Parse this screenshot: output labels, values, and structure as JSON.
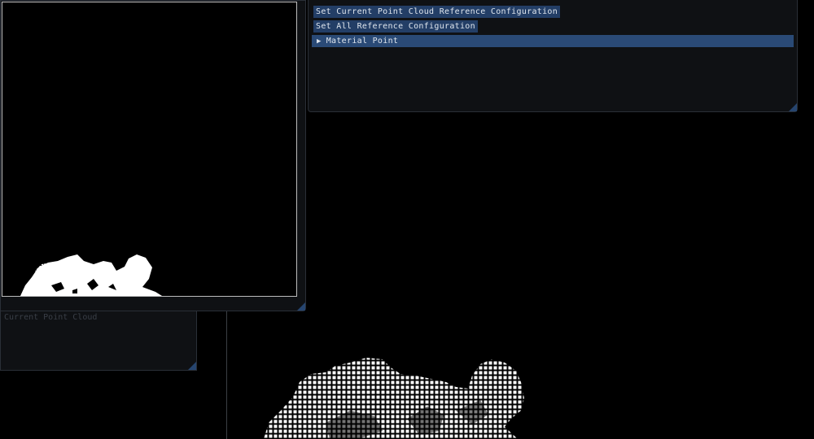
{
  "settings_panel": {
    "buttons": [
      {
        "label": "Set Current Point Cloud Reference Configuration"
      },
      {
        "label": "Set All Reference Configuration"
      }
    ],
    "tree_nodes": [
      {
        "label": "Material Point",
        "arrow": "▶",
        "expanded": false
      }
    ]
  },
  "background_panel": {
    "label": "Current Point Cloud"
  },
  "colors": {
    "window_bg": "#0f1114",
    "button": "#233e66",
    "header": "#2a4a76",
    "points": "#ffffff",
    "viewport": "#000000"
  }
}
